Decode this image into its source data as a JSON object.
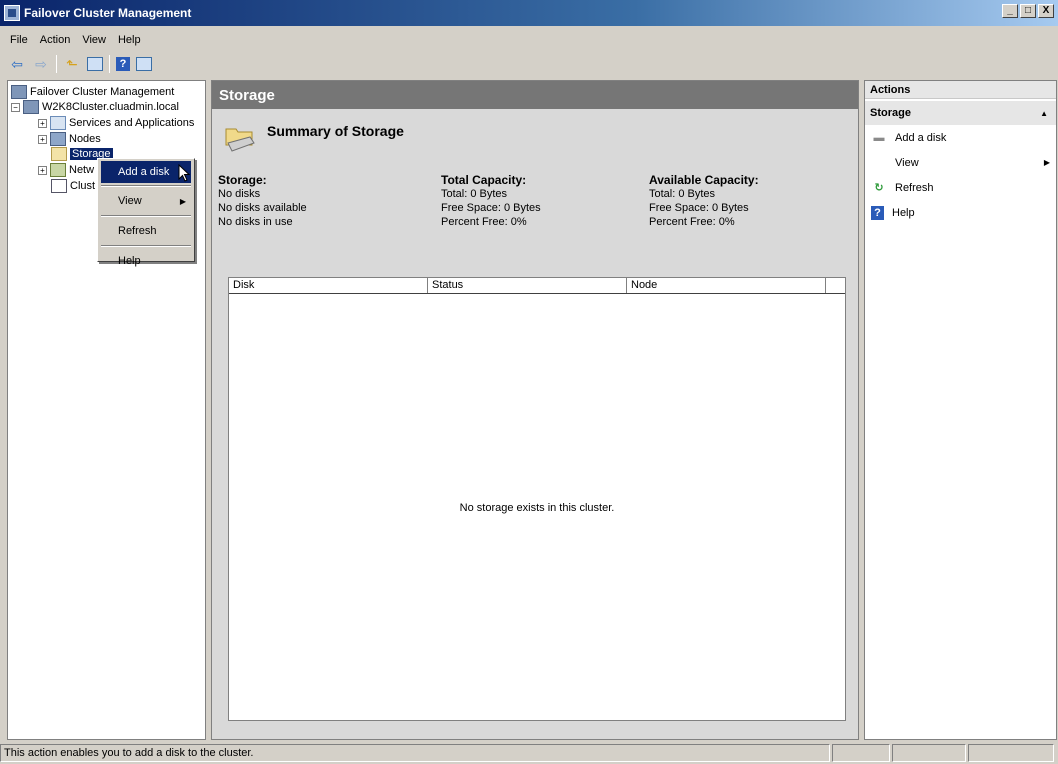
{
  "window": {
    "title": "Failover Cluster Management",
    "min": "_",
    "max": "□",
    "close": "X"
  },
  "menu": [
    "File",
    "Action",
    "View",
    "Help"
  ],
  "tree": {
    "root": "Failover Cluster Management",
    "cluster": "W2K8Cluster.cluadmin.local",
    "services": "Services and Applications",
    "nodes": "Nodes",
    "storage": "Storage",
    "networks": "Netw",
    "events": "Clust"
  },
  "context_menu": {
    "add_disk": "Add a disk",
    "view": "View",
    "refresh": "Refresh",
    "help": "Help"
  },
  "center": {
    "header": "Storage",
    "summary_title": "Summary of Storage",
    "storage_col": {
      "heading": "Storage:",
      "lines": [
        "No disks",
        "No disks available",
        "No disks in use"
      ]
    },
    "total_col": {
      "heading": "Total Capacity:",
      "lines": [
        "Total: 0 Bytes",
        "Free Space: 0 Bytes",
        "Percent Free: 0%"
      ]
    },
    "avail_col": {
      "heading": "Available Capacity:",
      "lines": [
        "Total: 0 Bytes",
        "Free Space: 0 Bytes",
        "Percent Free: 0%"
      ]
    },
    "columns": [
      "Disk",
      "Status",
      "Node"
    ],
    "empty_message": "No storage exists in this cluster."
  },
  "actions": {
    "title": "Actions",
    "section": "Storage",
    "items": [
      "Add a disk",
      "View",
      "Refresh",
      "Help"
    ]
  },
  "status_text": "This action enables you to add a disk to the cluster."
}
